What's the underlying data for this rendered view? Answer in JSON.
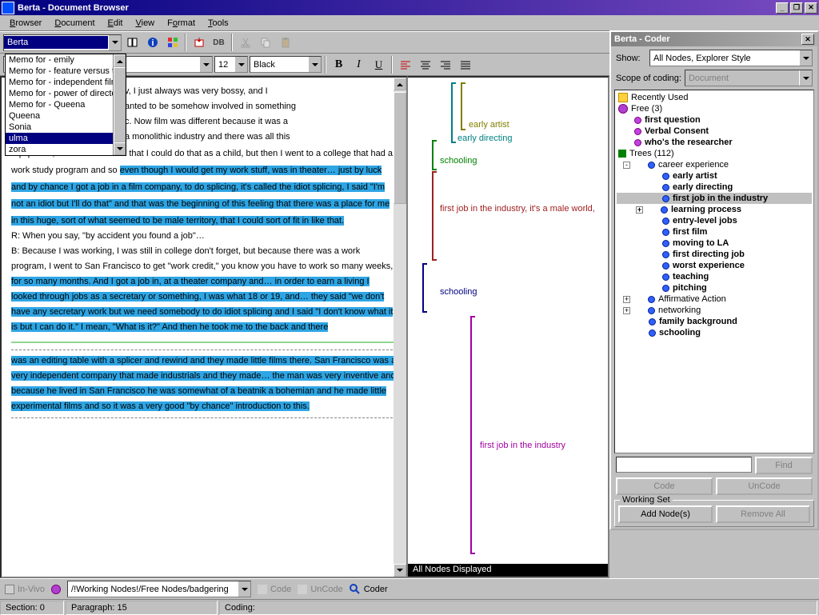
{
  "window": {
    "title": "Berta - Document Browser"
  },
  "menu": {
    "browser": "Browser",
    "document": "Document",
    "edit": "Edit",
    "view": "View",
    "format": "Format",
    "tools": "Tools"
  },
  "toolbar": {
    "doc_combo": "Berta",
    "db_label": "DB"
  },
  "format_bar": {
    "font_size": "12",
    "color": "Black"
  },
  "dropdown_items": [
    "Memo for - emily",
    "Memo for - feature versus te",
    "Memo for - independent film",
    "Memo for - power of director",
    "Memo for - Queena",
    "Queena",
    "Sonia",
    "ulma",
    "zora"
  ],
  "dropdown_selected": "ulma",
  "doc": {
    "p1a": "v, I just always was very bossy, and I",
    "p1b": "anted to be somehow involved in something",
    "p1c": "c.  Now film was different because it was a",
    "p1d": "a monolithic industry and there was all this",
    "p2": "equipment, that I did not think that I could do that as a child, but then I went to a college that had a work study program and so ",
    "p3": "even though I would get my work stuff, was in theater… just by luck and by chance I got a job in a film company, to do splicing, it's called the idiot splicing, I said \"I'm not an idiot but I'll do that\" and that was the beginning of this feeling that there was a place for me in this huge, sort of what seemed to be male territory, that I could sort of fit in like that.",
    "p4": "R:   When you say, \"by accident you found a job\"…",
    "p5": "B:   Because I was working, I was still in college don't forget, but because there was a work program, I went to San Francisco to get \"work credit,\" you know you have to work so many weeks, ",
    "p6": "for so many months.  And I got a job in, at a theater company and…  in order to earn a living I looked through jobs as a secretary or something, I was what 18 or 19, and…  they said \"we don't have any secretary work but we need somebody to do idiot splicing and I said \"I don't know what it is but I can do it.\"  I mean, \"What is it?\"  And then he took me to the back and there",
    "p7": "was an editing table with a splicer and rewind and they made little films there.  San Francisco was a very independent company that made industrials and they made…  the man was very inventive and because he lived in San Francisco he was somewhat of a beatnik a bohemian and he made little experimental films and so it was a very good \"by chance\" introduction to this."
  },
  "brackets": {
    "early_artist": "early artist",
    "early_directing": "early directing",
    "schooling": "schooling",
    "first_job_long": "first job in the industry, it's a male world,",
    "first_job": "first job in the industry"
  },
  "stripe_status": "All Nodes Displayed",
  "coder": {
    "title": "Berta - Coder",
    "show_label": "Show:",
    "show_value": "All Nodes, Explorer Style",
    "scope_label": "Scope of coding:",
    "scope_value": "Document",
    "recently_used": "Recently Used",
    "free_label": "Free (3)",
    "free_items": [
      "first question",
      "Verbal Consent",
      "who's the researcher"
    ],
    "trees_label": "Trees (112)",
    "career_exp": "career experience",
    "career_items": [
      "early artist",
      "early directing",
      "first job in the industry",
      "learning process",
      "entry-level jobs",
      "first film",
      "moving to LA",
      "first directing job",
      "worst experience",
      "teaching",
      "pitching"
    ],
    "career_selected": "first job in the industry",
    "aff_action": "Affirmative Action",
    "networking": "networking",
    "family_bg": "family background",
    "schooling_node": "schooling",
    "find_btn": "Find",
    "code_btn": "Code",
    "uncode_btn": "UnCode",
    "working_set": "Working Set",
    "add_nodes": "Add Node(s)",
    "remove_all": "Remove All"
  },
  "bottom": {
    "invivo": "In-Vivo",
    "path": "/!Working Nodes!/Free Nodes/badgering",
    "code": "Code",
    "uncode": "UnCode",
    "coder": "Coder"
  },
  "status": {
    "section": "Section: 0",
    "paragraph": "Paragraph: 15",
    "coding": "Coding:"
  }
}
